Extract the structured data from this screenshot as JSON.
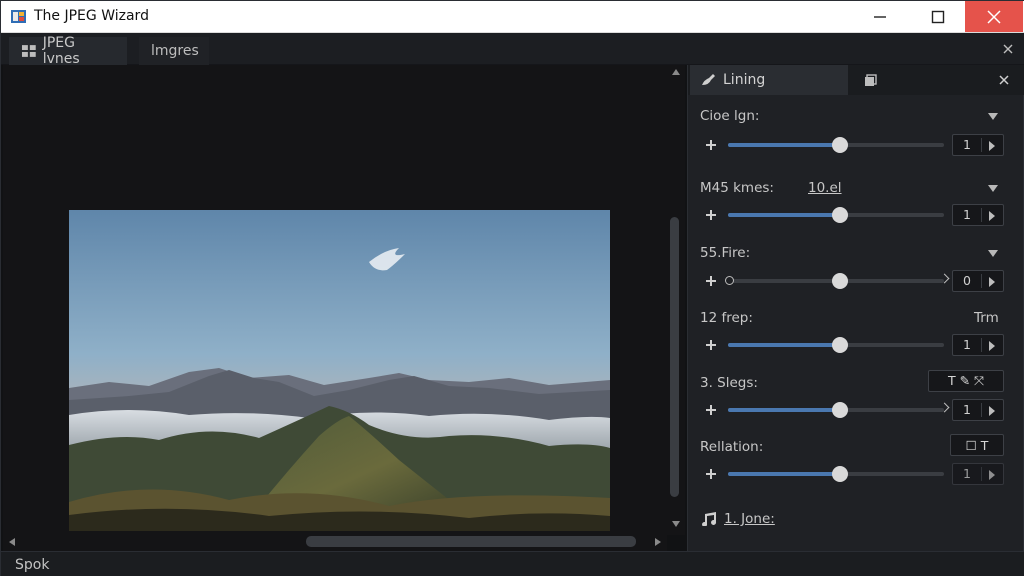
{
  "window": {
    "title": "The JPEG Wizard"
  },
  "tabs": [
    {
      "label": "JPEG lvnes",
      "icon": "grid-icon"
    },
    {
      "label": "lmgres"
    }
  ],
  "panel": {
    "tab_label": "Lining",
    "tab_icon": "brush-icon",
    "second_tab_icon": "layers-icon",
    "sections": [
      {
        "label": "Cioe lgn:",
        "value": "1",
        "level": 0.52
      },
      {
        "label": "M45 kmes:",
        "sub": "10.el",
        "value": "1",
        "level": 0.52
      },
      {
        "label": "55.Fire:",
        "value": "0",
        "level": 0.52
      },
      {
        "label": "12 frep:",
        "right": "Trm",
        "value": "1",
        "level": 0.52
      },
      {
        "label": "3. Slegs:",
        "tools": "T ✎ ⤧",
        "value": "1",
        "level": 0.52
      },
      {
        "label": "Rellation:",
        "tools": "☐ T",
        "value": "1",
        "level": 0.52
      }
    ],
    "footer_link": "1. Jone:"
  },
  "status": {
    "text": "Spok"
  },
  "colors": {
    "accent": "#4a78b0",
    "close_button": "#e5534b",
    "background": "#111214"
  }
}
